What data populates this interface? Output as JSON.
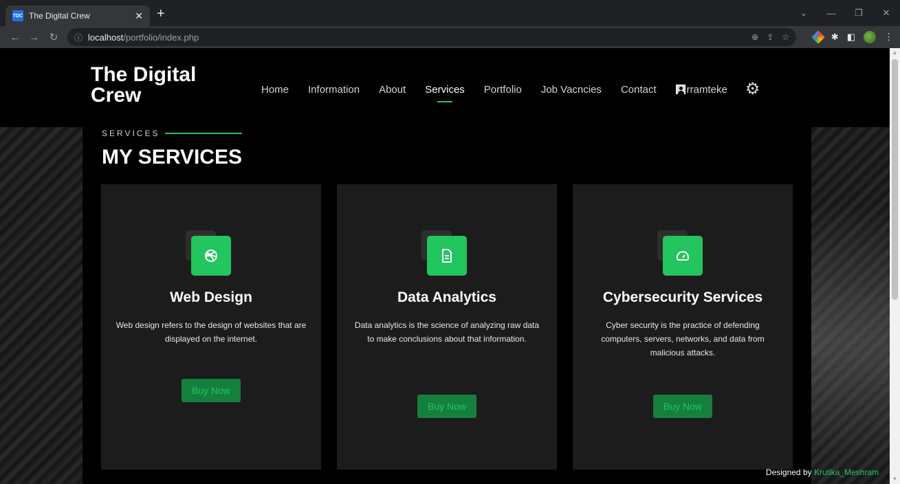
{
  "browser": {
    "tab_title": "The Digital Crew",
    "favicon_text": "TDC",
    "url_host": "localhost",
    "url_path": "/portfolio/index.php"
  },
  "site": {
    "logo": "The Digital Crew",
    "nav": [
      "Home",
      "Information",
      "About",
      "Services",
      "Portfolio",
      "Job Vacncies",
      "Contact"
    ],
    "active_nav": "Services",
    "username": "rramteke"
  },
  "section": {
    "eyebrow": "SERVICES",
    "title": "MY SERVICES"
  },
  "cards": [
    {
      "icon": "dribbble-icon",
      "title": "Web Design",
      "description": "Web design refers to the design of websites that are displayed on the internet.",
      "button": "Buy Now"
    },
    {
      "icon": "document-icon",
      "title": "Data Analytics",
      "description": "Data analytics is the science of analyzing raw data to make conclusions about that information.",
      "button": "Buy Now"
    },
    {
      "icon": "speedometer-icon",
      "title": "Cybersecurity Services",
      "description": "Cyber security is the practice of defending computers, servers, networks, and data from malicious attacks.",
      "button": "Buy Now"
    }
  ],
  "footer": {
    "prefix": "Designed by",
    "author": "Krutika_Meshram"
  },
  "colors": {
    "accent": "#22c55e",
    "button_bg": "#15803d",
    "card_bg": "#1c1c1c"
  }
}
